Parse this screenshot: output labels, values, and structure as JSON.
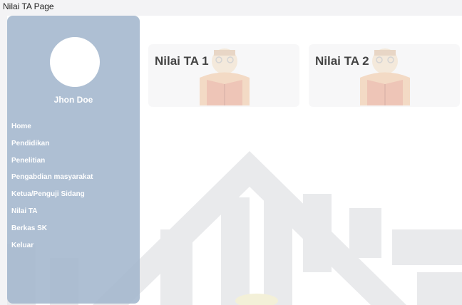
{
  "window": {
    "title": "Nilai TA Page"
  },
  "profile": {
    "name": "Jhon Doe"
  },
  "sidebar": {
    "items": [
      {
        "label": "Home"
      },
      {
        "label": "Pendidikan"
      },
      {
        "label": "Penelitian"
      },
      {
        "label": "Pengabdian masyarakat"
      },
      {
        "label": "Ketua/Penguji Sidang"
      },
      {
        "label": "Nilai TA"
      },
      {
        "label": "Berkas SK"
      },
      {
        "label": "Keluar"
      }
    ]
  },
  "cards": [
    {
      "title": "Nilai TA 1"
    },
    {
      "title": "Nilai TA 2"
    }
  ],
  "colors": {
    "sidebar": "#a3b6cd",
    "canvas": "#ffffff",
    "watermark": "#e9eaec"
  }
}
